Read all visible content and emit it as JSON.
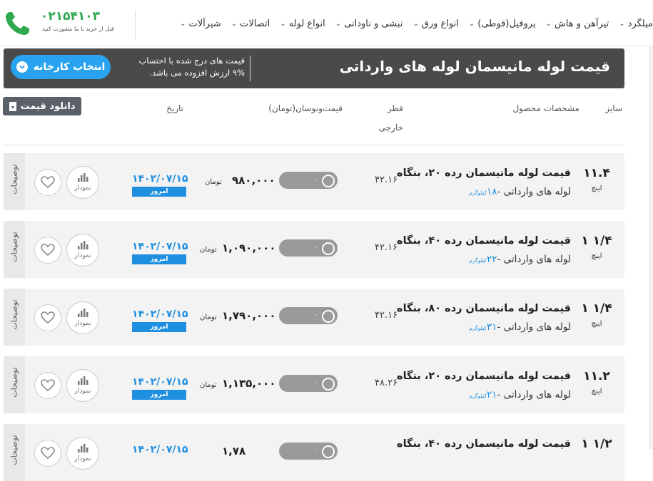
{
  "nav": {
    "phone_number": "۰۲۱۵۴۱۰۳",
    "phone_subtitle": "قبل از خرید با ما مشورت کنید",
    "menu": [
      {
        "label": "میلگرد"
      },
      {
        "label": "تیرآهن و هاش"
      },
      {
        "label": "پروفیل(قوطی)"
      },
      {
        "label": "انواع ورق"
      },
      {
        "label": "نبشی و ناودانی"
      },
      {
        "label": "انواع لوله"
      },
      {
        "label": "اتصالات"
      },
      {
        "label": "شیرآلات"
      }
    ]
  },
  "banner": {
    "title": "قیمت لوله مانیسمان لوله های وارداتی",
    "note_line1": "قیمت های درج شده با احتساب",
    "note_line2": "۹% ارزش افزوده می باشد.",
    "factory_button": "انتخاب کارخانه"
  },
  "download_button": "دانلود قیمت",
  "table_headers": {
    "size": "سایز",
    "specs": "مشخصات محصول",
    "diameter_line1": "قطر",
    "diameter_line2": "خارجی",
    "price": "قیمت‌ونوسان(تومان)",
    "date": "تاریخ"
  },
  "row_labels": {
    "details": "توضیحات",
    "chart": "نمودار",
    "today": "امروز",
    "currency": "تومان",
    "size_unit": "اینچ",
    "toggle_zero": "۰"
  },
  "rows": [
    {
      "size": "۱۱.۴",
      "name": "قیمت لوله مانیسمان رده ۲۰، بنگاه",
      "sub": "لوله های وارداتی -",
      "weight": "۱۸",
      "weight_unit": "کیلوگرم",
      "diameter": "۴۲.۱۶",
      "price": "۹۸۰,۰۰۰",
      "date": "۱۴۰۲/۰۷/۱۵"
    },
    {
      "size": "۱ ۱/۴",
      "name": "قیمت لوله مانیسمان رده ۴۰، بنگاه",
      "sub": "لوله های وارداتی -",
      "weight": "۲۲",
      "weight_unit": "کیلوگرم",
      "diameter": "۴۲.۱۶",
      "price": "۱,۰۹۰,۰۰۰",
      "date": "۱۴۰۲/۰۷/۱۵"
    },
    {
      "size": "۱ ۱/۴",
      "name": "قیمت لوله مانیسمان رده ۸۰، بنگاه",
      "sub": "لوله های وارداتی -",
      "weight": "۳۱",
      "weight_unit": "کیلوگرم",
      "diameter": "۴۲.۱۶",
      "price": "۱,۷۹۰,۰۰۰",
      "date": "۱۴۰۲/۰۷/۱۵"
    },
    {
      "size": "۱۱.۲",
      "name": "قیمت لوله مانیسمان رده ۲۰، بنگاه",
      "sub": "لوله های وارداتی -",
      "weight": "۲۱",
      "weight_unit": "کیلوگرم",
      "diameter": "۴۸.۲۶",
      "price": "۱,۱۳۵,۰۰۰",
      "date": "۱۴۰۲/۰۷/۱۵"
    },
    {
      "size": "۱ ۱/۲",
      "name": "قیمت لوله مانیسمان رده ۴۰، بنگاه",
      "sub": "",
      "weight": "",
      "weight_unit": "",
      "diameter": "",
      "price": "۱,۷۸",
      "date": "۱۴۰۲/۰۷/۱۵"
    }
  ],
  "colors": {
    "brand_green": "#2fa84f",
    "accent_blue": "#1f8fe0",
    "banner_bg": "#4a4a4a",
    "toggle_gray": "#9a9a9a"
  }
}
